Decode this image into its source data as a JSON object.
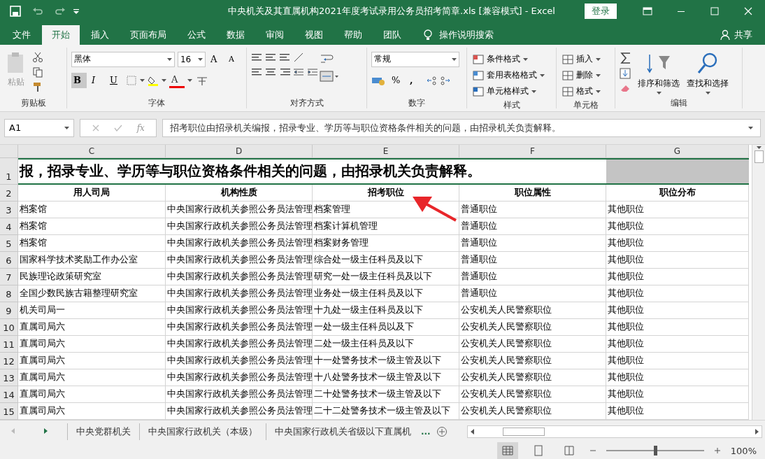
{
  "window": {
    "title": "中央机关及其直属机构2021年度考试录用公务员招考简章.xls  [兼容模式]  -  Excel",
    "login_button": "登录"
  },
  "ribbon_tabs": [
    {
      "label": "文件",
      "selected": false
    },
    {
      "label": "开始",
      "selected": true
    },
    {
      "label": "插入",
      "selected": false
    },
    {
      "label": "页面布局",
      "selected": false
    },
    {
      "label": "公式",
      "selected": false
    },
    {
      "label": "数据",
      "selected": false
    },
    {
      "label": "审阅",
      "selected": false
    },
    {
      "label": "视图",
      "selected": false
    },
    {
      "label": "帮助",
      "selected": false
    },
    {
      "label": "团队",
      "selected": false
    }
  ],
  "tell_me": "操作说明搜索",
  "share": "共享",
  "ribbon": {
    "clipboard": {
      "paste": "粘贴",
      "label": "剪贴板"
    },
    "font": {
      "name": "黑体",
      "size": "16",
      "grow": "A",
      "shrink": "A",
      "styles": [
        "B",
        "I",
        "U"
      ],
      "color_letter": "A",
      "label": "字体"
    },
    "alignment": {
      "label": "对齐方式"
    },
    "number": {
      "format": "常规",
      "percent": "%",
      "comma": ",",
      "label": "数字"
    },
    "styles": {
      "items": [
        "条件格式",
        "套用表格格式",
        "单元格样式"
      ],
      "label": "样式"
    },
    "cells": {
      "items": [
        "插入",
        "删除",
        "格式"
      ],
      "label": "单元格"
    },
    "editing": {
      "sort": "排序和筛选",
      "find": "查找和选择",
      "label": "编辑"
    }
  },
  "formula_bar": {
    "name_box": "A1",
    "fx": "fx",
    "formula": "招考职位由招录机关编报，招录专业、学历等与职位资格条件相关的问题，由招录机关负责解释。"
  },
  "sheet": {
    "columns": [
      "C",
      "D",
      "E",
      "F",
      "G"
    ],
    "title_row": {
      "number": "1",
      "text": "报，招录专业、学历等与职位资格条件相关的问题，由招录机关负责解释。"
    },
    "header_row": {
      "number": "2",
      "cells": [
        "用人司局",
        "机构性质",
        "招考职位",
        "职位属性",
        "职位分布"
      ]
    },
    "rows": [
      {
        "number": "3",
        "cells": [
          "档案馆",
          "中央国家行政机关参照公务员法管理",
          "档案管理",
          "普通职位",
          "其他职位"
        ]
      },
      {
        "number": "4",
        "cells": [
          "档案馆",
          "中央国家行政机关参照公务员法管理",
          "档案计算机管理",
          "普通职位",
          "其他职位"
        ]
      },
      {
        "number": "5",
        "cells": [
          "档案馆",
          "中央国家行政机关参照公务员法管理",
          "档案财务管理",
          "普通职位",
          "其他职位"
        ]
      },
      {
        "number": "6",
        "cells": [
          "国家科学技术奖励工作办公室",
          "中央国家行政机关参照公务员法管理",
          "综合处一级主任科员及以下",
          "普通职位",
          "其他职位"
        ]
      },
      {
        "number": "7",
        "cells": [
          "民族理论政策研究室",
          "中央国家行政机关参照公务员法管理",
          "研究一处一级主任科员及以下",
          "普通职位",
          "其他职位"
        ]
      },
      {
        "number": "8",
        "cells": [
          "全国少数民族古籍整理研究室",
          "中央国家行政机关参照公务员法管理",
          "业务处一级主任科员及以下",
          "普通职位",
          "其他职位"
        ]
      },
      {
        "number": "9",
        "cells": [
          "机关司局一",
          "中央国家行政机关参照公务员法管理",
          "十九处一级主任科员及以下",
          "公安机关人民警察职位",
          "其他职位"
        ]
      },
      {
        "number": "10",
        "cells": [
          "直属司局六",
          "中央国家行政机关参照公务员法管理",
          "一处一级主任科员以及下",
          "公安机关人民警察职位",
          "其他职位"
        ]
      },
      {
        "number": "11",
        "cells": [
          "直属司局六",
          "中央国家行政机关参照公务员法管理",
          "二处一级主任科员及以下",
          "公安机关人民警察职位",
          "其他职位"
        ]
      },
      {
        "number": "12",
        "cells": [
          "直属司局六",
          "中央国家行政机关参照公务员法管理",
          "十一处警务技术一级主管及以下",
          "公安机关人民警察职位",
          "其他职位"
        ]
      },
      {
        "number": "13",
        "cells": [
          "直属司局六",
          "中央国家行政机关参照公务员法管理",
          "十八处警务技术一级主管及以下",
          "公安机关人民警察职位",
          "其他职位"
        ]
      },
      {
        "number": "14",
        "cells": [
          "直属司局六",
          "中央国家行政机关参照公务员法管理",
          "二十处警务技术一级主管及以下",
          "公安机关人民警察职位",
          "其他职位"
        ]
      },
      {
        "number": "15",
        "cells": [
          "直属司局六",
          "中央国家行政机关参照公务员法管理",
          "二十二处警务技术一级主管及以下",
          "公安机关人民警察职位",
          "其他职位"
        ]
      }
    ]
  },
  "sheet_tabs": [
    {
      "label": "中央党群机关",
      "selected": false
    },
    {
      "label": "中央国家行政机关（本级）",
      "selected": false
    },
    {
      "label": "中央国家行政机关省级以下直属机",
      "selected": false
    }
  ],
  "more_tabs": "...",
  "status_bar": {
    "zoom": "100%",
    "zoom_slider": {
      "level": 0.5
    }
  }
}
